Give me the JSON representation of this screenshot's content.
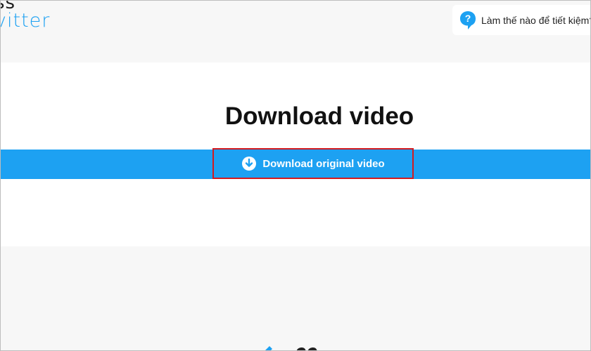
{
  "header": {
    "logo_top": "ss",
    "logo_bottom": "vitter",
    "help_text": "Làm thế nào để tiết kiệm?"
  },
  "main": {
    "title": "Download video",
    "download_button_label": "Download original video"
  },
  "colors": {
    "brand_blue": "#1da1f2",
    "highlight_red": "#d31a1f"
  },
  "icons": {
    "help": "question-bubble-icon",
    "download": "download-arrow-circle-icon"
  }
}
